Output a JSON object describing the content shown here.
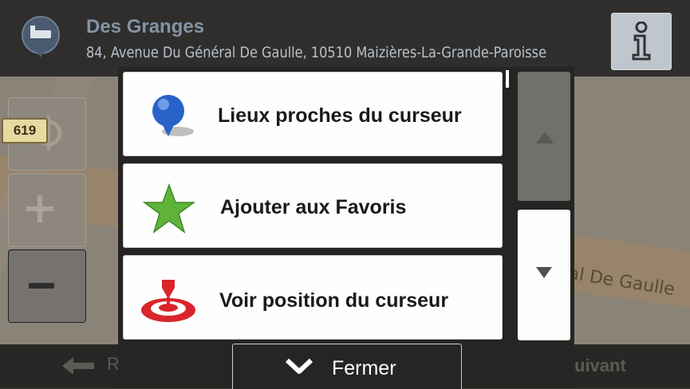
{
  "header": {
    "place_name": "Des Granges",
    "place_address": "84, Avenue Du Général De Gaulle, 10510 Maizières-La-Grande-Paroisse",
    "pin_icon": "hotel-pin-icon",
    "info_icon": "info-icon"
  },
  "map": {
    "road_number": "619",
    "street_label": "al De Gaulle"
  },
  "controls": {
    "compass_icon": "compass-icon",
    "zoom_in_icon": "plus-icon",
    "zoom_out_icon": "minus-icon"
  },
  "menu": {
    "items": [
      {
        "label": "Lieux proches du curseur",
        "icon": "blue-pin-icon"
      },
      {
        "label": "Ajouter aux Favoris",
        "icon": "green-star-icon"
      },
      {
        "label": "Voir position du curseur",
        "icon": "red-target-icon"
      }
    ],
    "close_label": "Fermer"
  },
  "bottombar": {
    "back_label": "R",
    "next_label": "uivant"
  },
  "colors": {
    "header_bg": "#2f2e2c",
    "menu_item_bg": "#fefefe",
    "star_green": "#5fb33a",
    "target_red": "#d9262b",
    "pin_blue": "#2a62c9"
  }
}
